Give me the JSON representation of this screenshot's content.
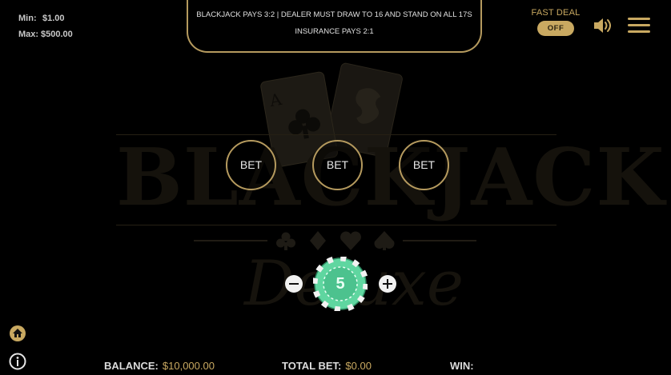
{
  "limits": {
    "min_label": "Min:",
    "min_value": "$1.00",
    "max_label": "Max:",
    "max_value": "$500.00"
  },
  "rules": {
    "line1": "BLACKJACK PAYS 3:2 | DEALER MUST DRAW TO 16 AND STAND ON ALL 17S",
    "line2": "INSURANCE PAYS 2:1"
  },
  "fast_deal": {
    "label": "FAST DEAL",
    "state": "OFF"
  },
  "logo": {
    "word": "BLACKJACK",
    "subtitle": "Deluxe",
    "card_rank": "A"
  },
  "bet_spots": [
    {
      "label": "BET"
    },
    {
      "label": "BET"
    },
    {
      "label": "BET"
    }
  ],
  "chip": {
    "value": "5"
  },
  "footer": {
    "balance_label": "BALANCE:",
    "balance_value": "$10,000.00",
    "total_bet_label": "TOTAL BET:",
    "total_bet_value": "$0.00",
    "win_label": "WIN:",
    "win_value": ""
  },
  "icons": {
    "sound": "speaker-icon",
    "menu": "hamburger-menu-icon",
    "home": "home-icon",
    "info": "info-icon"
  },
  "colors": {
    "gold": "#c9a961",
    "gold_border": "#b59a5e",
    "chip_green": "#5fd6a0",
    "background": "#000000"
  }
}
